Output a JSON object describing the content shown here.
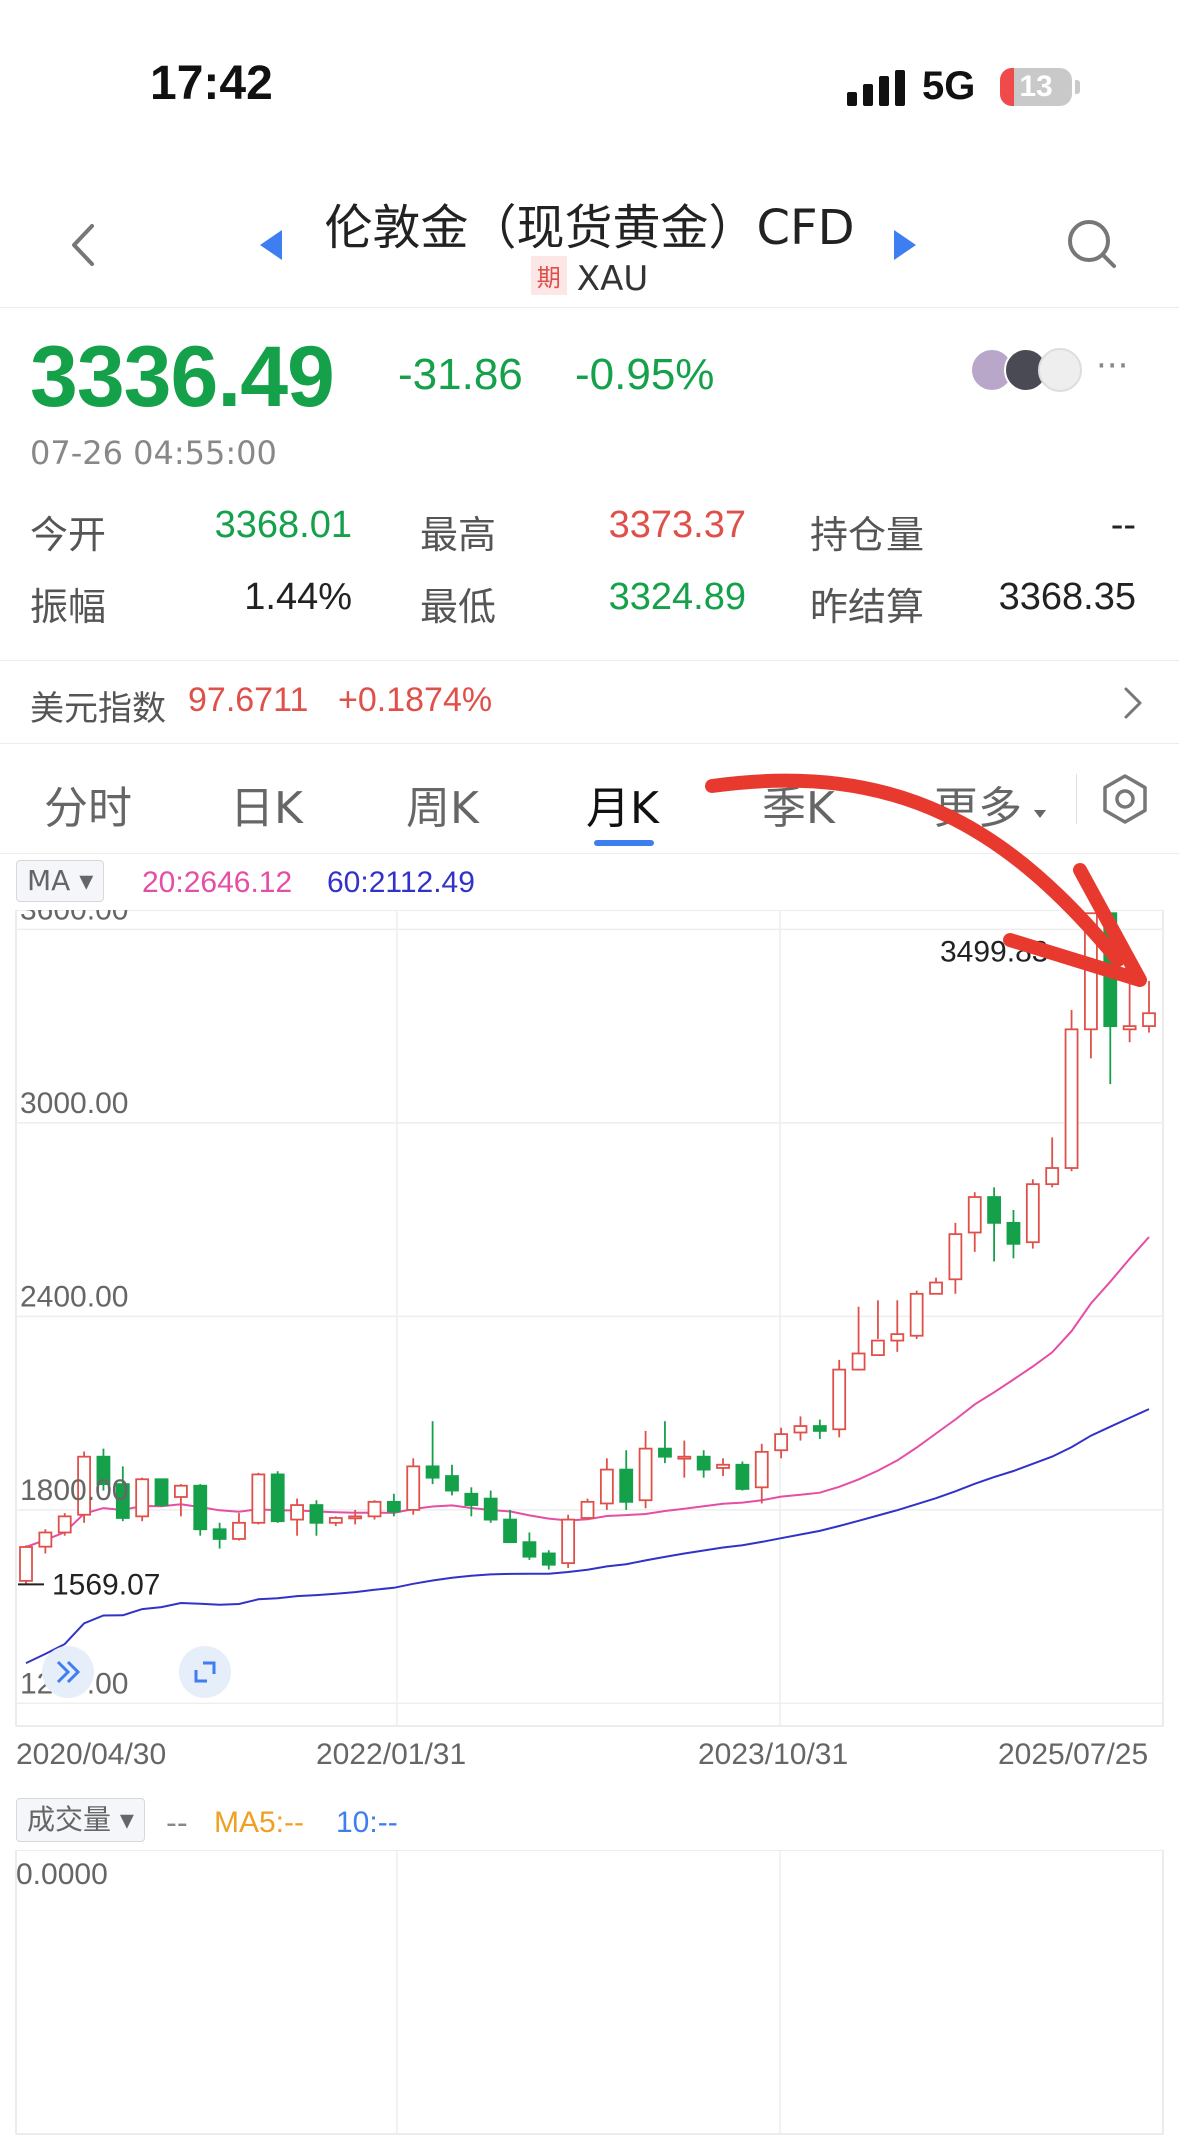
{
  "status_bar": {
    "time": "17:42",
    "network": "5G",
    "battery": "13"
  },
  "nav": {
    "title": "伦敦金（现货黄金）CFD",
    "badge": "期",
    "symbol": "XAU"
  },
  "quote": {
    "price": "3336.49",
    "change": "-31.86",
    "change_pct": "-0.95%",
    "time": "07-26 04:55:00",
    "more": "···",
    "stats": {
      "open_label": "今开",
      "open": "3368.01",
      "high_label": "最高",
      "high": "3373.37",
      "oi_label": "持仓量",
      "oi": "--",
      "amp_label": "振幅",
      "amp": "1.44%",
      "low_label": "最低",
      "low": "3324.89",
      "prev_label": "昨结算",
      "prev": "3368.35"
    }
  },
  "index_row": {
    "label": "美元指数",
    "value": "97.6711",
    "change": "+0.1874%"
  },
  "tabs": [
    "分时",
    "日K",
    "周K",
    "月K",
    "季K",
    "更多"
  ],
  "active_tab": "月K",
  "ma": {
    "selector": "MA",
    "ma20": "20:2646.12",
    "ma60": "60:2112.49"
  },
  "volume": {
    "selector": "成交量",
    "dash": "--",
    "ma5": "MA5:--",
    "ma10": "10:--",
    "axis_value": "0.0000"
  },
  "colors": {
    "up": "#e0504a",
    "down": "#15a04a",
    "ma20": "#e54ea4",
    "ma60": "#3232c8",
    "accent": "#3d7ef0",
    "annotation": "#e8392f"
  },
  "chart_data": {
    "type": "candlestick",
    "title": "",
    "x_ticks": [
      "2020/04/30",
      "2022/01/31",
      "2023/10/31",
      "2025/07/25"
    ],
    "y_ticks": [
      "3600.00",
      "3000.00",
      "2400.00",
      "1800.00",
      "1200.00"
    ],
    "ylim": [
      1130,
      3660
    ],
    "max_label": "3499.83",
    "min_label": "1569.07",
    "ma_series": [
      {
        "name": "20",
        "last": 2646.12
      },
      {
        "name": "60",
        "last": 2112.49
      }
    ],
    "candles": [
      [
        1580,
        1685,
        1569,
        1690
      ],
      [
        1686,
        1730,
        1665,
        1740
      ],
      [
        1730,
        1780,
        1720,
        1790
      ],
      [
        1785,
        1965,
        1760,
        1981
      ],
      [
        1965,
        1880,
        1860,
        1990
      ],
      [
        1880,
        1775,
        1765,
        1935
      ],
      [
        1780,
        1895,
        1765,
        1900
      ],
      [
        1895,
        1815,
        1810,
        1875
      ],
      [
        1840,
        1875,
        1780,
        1880
      ],
      [
        1875,
        1740,
        1720,
        1880
      ],
      [
        1740,
        1710,
        1680,
        1760
      ],
      [
        1710,
        1760,
        1705,
        1790
      ],
      [
        1760,
        1910,
        1755,
        1915
      ],
      [
        1910,
        1765,
        1760,
        1920
      ],
      [
        1770,
        1815,
        1720,
        1835
      ],
      [
        1815,
        1760,
        1720,
        1830
      ],
      [
        1760,
        1775,
        1750,
        1780
      ],
      [
        1775,
        1780,
        1755,
        1800
      ],
      [
        1780,
        1825,
        1770,
        1830
      ],
      [
        1825,
        1795,
        1780,
        1850
      ],
      [
        1800,
        1935,
        1785,
        1960
      ],
      [
        1935,
        1900,
        1880,
        2075
      ],
      [
        1905,
        1860,
        1845,
        1940
      ],
      [
        1850,
        1815,
        1780,
        1870
      ],
      [
        1835,
        1770,
        1760,
        1860
      ],
      [
        1770,
        1700,
        1700,
        1800
      ],
      [
        1700,
        1655,
        1645,
        1730
      ],
      [
        1665,
        1630,
        1615,
        1675
      ],
      [
        1635,
        1770,
        1620,
        1785
      ],
      [
        1775,
        1825,
        1770,
        1835
      ],
      [
        1820,
        1925,
        1800,
        1960
      ],
      [
        1925,
        1825,
        1800,
        1985
      ],
      [
        1830,
        1990,
        1805,
        2045
      ],
      [
        1990,
        1965,
        1945,
        2075
      ],
      [
        1965,
        1965,
        1900,
        2015
      ],
      [
        1965,
        1925,
        1900,
        1985
      ],
      [
        1930,
        1940,
        1905,
        1960
      ],
      [
        1940,
        1865,
        1860,
        1950
      ],
      [
        1870,
        1980,
        1820,
        2005
      ],
      [
        1985,
        2035,
        1960,
        2055
      ],
      [
        2040,
        2060,
        2015,
        2090
      ],
      [
        2060,
        2045,
        2020,
        2080
      ],
      [
        2050,
        2235,
        2025,
        2265
      ],
      [
        2235,
        2285,
        2275,
        2430
      ],
      [
        2280,
        2325,
        2330,
        2450
      ],
      [
        2325,
        2345,
        2290,
        2450
      ],
      [
        2340,
        2470,
        2330,
        2480
      ],
      [
        2470,
        2505,
        2470,
        2520
      ],
      [
        2515,
        2655,
        2470,
        2690
      ],
      [
        2660,
        2770,
        2600,
        2785
      ],
      [
        2770,
        2690,
        2570,
        2800
      ],
      [
        2690,
        2625,
        2580,
        2730
      ],
      [
        2630,
        2810,
        2610,
        2825
      ],
      [
        2810,
        2860,
        2800,
        2955
      ],
      [
        2860,
        3290,
        2850,
        3350
      ],
      [
        3290,
        3650,
        3200,
        3500
      ],
      [
        3650,
        3300,
        3120,
        3500
      ],
      [
        3290,
        3300,
        3250,
        3450
      ],
      [
        3300,
        3340,
        3280,
        3440
      ]
    ]
  }
}
